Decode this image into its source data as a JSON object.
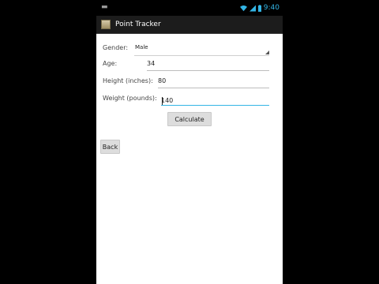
{
  "status_bar": {
    "time": "9:40"
  },
  "app": {
    "title": "Point Tracker"
  },
  "form": {
    "gender": {
      "label": "Gender:",
      "value": "Male"
    },
    "age": {
      "label": "Age:",
      "value": "34"
    },
    "height": {
      "label": "Height (inches):",
      "value": "80"
    },
    "weight": {
      "label": "Weight (pounds):",
      "value": "140"
    }
  },
  "buttons": {
    "calculate": "Calculate",
    "back": "Back"
  }
}
